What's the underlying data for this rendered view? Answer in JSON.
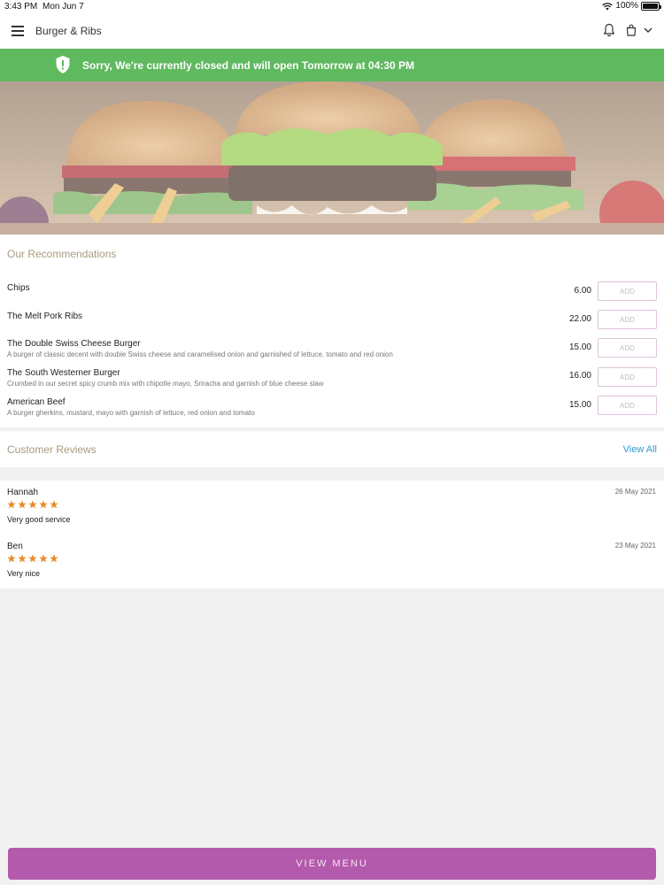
{
  "status_bar": {
    "time": "3:43 PM",
    "date": "Mon Jun 7",
    "battery": "100%"
  },
  "nav": {
    "title": "Burger & Ribs"
  },
  "banner": {
    "text": "Sorry, We're currently closed and will open Tomorrow at 04:30 PM",
    "color": "#5fb95f"
  },
  "recommendations": {
    "title": "Our Recommendations",
    "add_label": "ADD",
    "items": [
      {
        "name": "Chips",
        "description": "",
        "price": "6.00"
      },
      {
        "name": "The Melt Pork Ribs",
        "description": "",
        "price": "22.00"
      },
      {
        "name": "The Double Swiss Cheese Burger",
        "description": "A burger of classic decent with double Swiss cheese and caramelised onion and garnished of lettuce, tomato and red onion",
        "price": "15.00"
      },
      {
        "name": "The South Westerner Burger",
        "description": "Crumbed in our secret spicy crumb mix with chipotle mayo, Sriracha and garnish of blue cheese slaw",
        "price": "16.00"
      },
      {
        "name": "American Beef",
        "description": "A burger gherkins, mustard, mayo with garnish of lettuce, red onion and tomato",
        "price": "15.00"
      }
    ]
  },
  "reviews": {
    "title": "Customer Reviews",
    "view_all": "View All",
    "items": [
      {
        "name": "Hannah",
        "date": "26 May 2021",
        "rating": 5,
        "text": "Very good service"
      },
      {
        "name": "Ben",
        "date": "23 May 2021",
        "rating": 5,
        "text": "Very nice"
      }
    ]
  },
  "footer": {
    "view_menu_label": "VIEW MENU",
    "accent": "#b45aac"
  },
  "icons": [
    "menu-icon",
    "bell-icon",
    "bag-icon",
    "chevron-down-icon",
    "shield-icon",
    "wifi-icon",
    "battery-icon",
    "star-icon"
  ]
}
